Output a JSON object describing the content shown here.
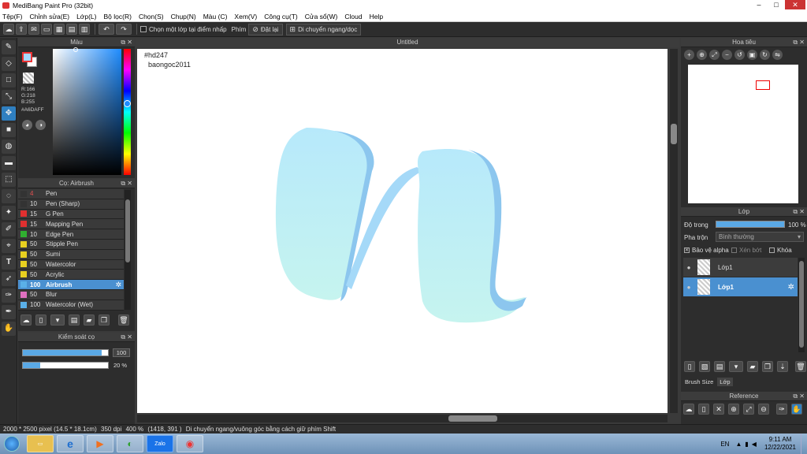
{
  "app": {
    "title": "MediBang Paint Pro (32bit)"
  },
  "menu": [
    "Tệp(F)",
    "Chỉnh sửa(E)",
    "Lớp(L)",
    "Bộ lọc(R)",
    "Chọn(S)",
    "Chụp(N)",
    "Màu (C)",
    "Xem(V)",
    "Công cụ(T)",
    "Cửa sổ(W)",
    "Cloud",
    "Help"
  ],
  "toolbar": {
    "snap_label": "Chọn một lớp tại điểm nhấp",
    "key_label": "Phím",
    "reset_label": "Đặt lại",
    "move_label": "Di chuyển ngang/dọc"
  },
  "color_panel": {
    "title": "Màu",
    "r": "R:166",
    "g": "G:218",
    "b": "B:255",
    "hex": "#A6DAFF",
    "fg_color": "#A6DAFF",
    "bg_color": "#FFFFFF"
  },
  "brush_panel": {
    "title": "Cọ: Airbrush",
    "items": [
      {
        "size": "4",
        "name": "Pen",
        "color": "#333333"
      },
      {
        "size": "10",
        "name": "Pen (Sharp)",
        "color": "#333333"
      },
      {
        "size": "15",
        "name": "G Pen",
        "color": "#e03030"
      },
      {
        "size": "15",
        "name": "Mapping Pen",
        "color": "#e03030"
      },
      {
        "size": "10",
        "name": "Edge Pen",
        "color": "#30b030"
      },
      {
        "size": "50",
        "name": "Stipple Pen",
        "color": "#e8d020"
      },
      {
        "size": "50",
        "name": "Sumi",
        "color": "#e8d020"
      },
      {
        "size": "50",
        "name": "Watercolor",
        "color": "#e8d020"
      },
      {
        "size": "50",
        "name": "Acrylic",
        "color": "#e8d020"
      },
      {
        "size": "100",
        "name": "Airbrush",
        "color": "#5ab0e8",
        "selected": true
      },
      {
        "size": "50",
        "name": "Blur",
        "color": "#e070c0"
      },
      {
        "size": "100",
        "name": "Watercolor (Wet)",
        "color": "#5ab0e8"
      }
    ]
  },
  "control_panel": {
    "title": "Kiểm soát cọ",
    "size_value": "100",
    "size_fill": 0.93,
    "opacity_value": "20 %",
    "opacity_fill": 0.2
  },
  "canvas": {
    "tab_title": "Untitled",
    "text_line1": "#hd247",
    "text_line2": "baongoc2011"
  },
  "navigator": {
    "title": "Hoa tiêu"
  },
  "layers": {
    "title": "Lớp",
    "opacity_label": "Độ trong",
    "opacity_value": "100 %",
    "opacity_fill": 1.0,
    "blend_label": "Pha trộn",
    "blend_value": "Bình thường",
    "protect_alpha": "Bảo vệ alpha",
    "clipping": "Xén bớt",
    "lock": "Khóa",
    "items": [
      {
        "name": "Lớp1",
        "selected": false
      },
      {
        "name": "Lớp1",
        "selected": true
      }
    ],
    "tab_brush_size": "Brush Size",
    "tab_layer": "Lớp"
  },
  "reference": {
    "title": "Reference"
  },
  "status": {
    "size": "2000 * 2500 pixel",
    "cm": "(14.5 * 18.1cm)",
    "dpi": "350 dpi",
    "zoom": "400 %",
    "coords": "(1418, 391 )",
    "hint": "Di chuyển ngang/vuông góc bằng cách giữ phím Shift"
  },
  "taskbar": {
    "lang": "EN",
    "time": "9:11 AM",
    "date": "12/22/2021",
    "zalo": "Zalo"
  }
}
